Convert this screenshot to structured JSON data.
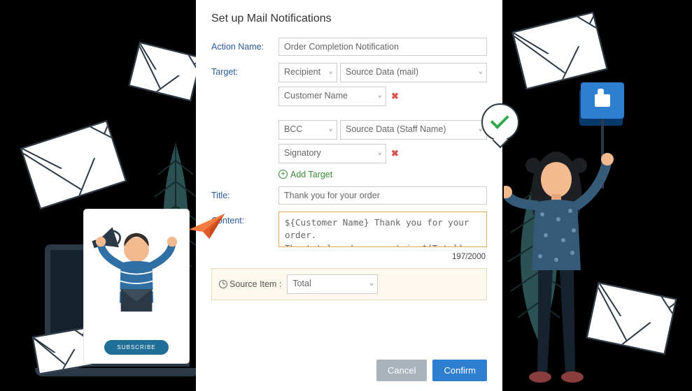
{
  "title": "Set up Mail Notifications",
  "labels": {
    "actionName": "Action Name:",
    "target": "Target:",
    "title": "Title:",
    "content": "Content:",
    "addTarget": "Add Target",
    "sourceItem": "Source Item  :"
  },
  "form": {
    "actionName": "Order Completion Notification",
    "target1": {
      "type": "Recipient",
      "source": "Source Data (mail)",
      "field": "Customer Name"
    },
    "target2": {
      "type": "BCC",
      "source": "Source Data (Staff Name)",
      "field": "Signatory"
    },
    "titleValue": "Thank you for your order",
    "content": "${Customer Name} Thank you for your order.\nThe total order amount is ${Total}\nFor group orders, you can download the order form at the following link: ${PDF download link}",
    "count": "197/2000",
    "sourceItem": "Total"
  },
  "buttons": {
    "cancel": "Cancel",
    "confirm": "Confirm",
    "subscribe": "SUBSCRIBE"
  }
}
